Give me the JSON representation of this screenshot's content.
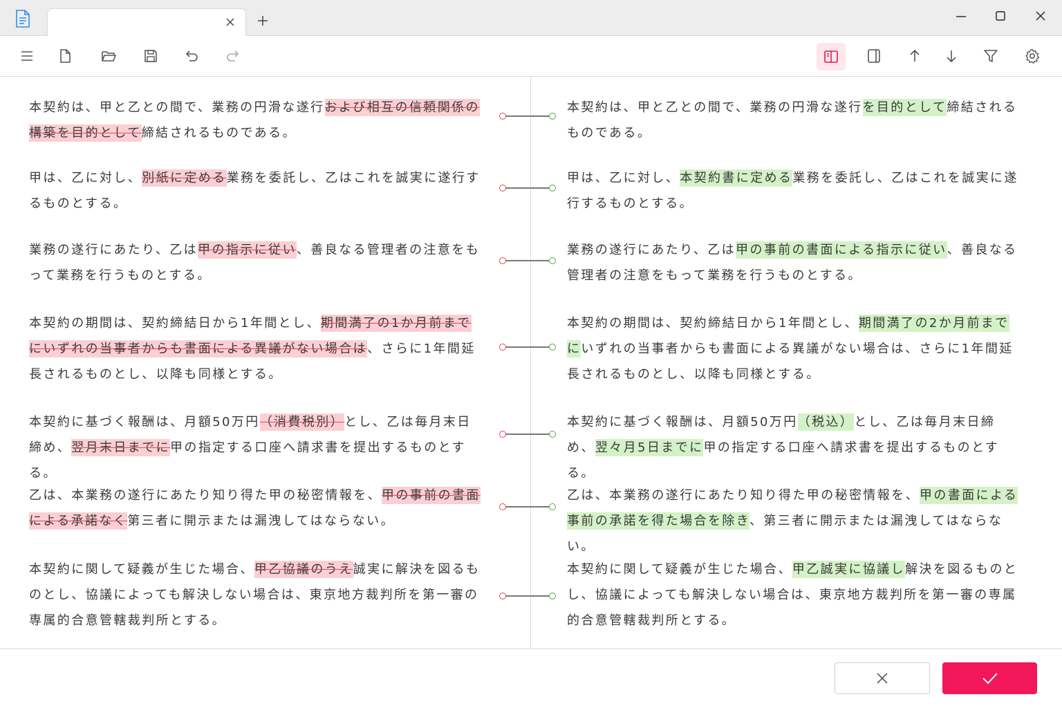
{
  "window": {
    "tab_title": "",
    "icons": {
      "app": "document-icon",
      "close_tab": "close-icon",
      "new_tab": "plus-icon",
      "minimize": "minimize-icon",
      "maximize": "maximize-icon",
      "close": "close-icon"
    }
  },
  "toolbar": {
    "buttons": [
      "menu-icon",
      "new-file-icon",
      "open-folder-icon",
      "save-icon",
      "undo-icon",
      "redo-icon",
      "side-by-side-view-icon",
      "single-pane-view-icon",
      "previous-change-icon",
      "next-change-icon",
      "filter-icon",
      "settings-icon"
    ],
    "active": "side-by-side-view-icon"
  },
  "colors": {
    "deleted_bg": "#fbcfd3",
    "deleted_strike": "#e0485c",
    "inserted_bg": "#d4f2c7",
    "accent": "#f2165a",
    "active_bg": "#fde7ec"
  },
  "diff": {
    "left": [
      [
        {
          "t": "本契約は、甲と乙との間で、業務の円滑な遂行"
        },
        {
          "t": "および相互の信頼関係の構築を目的として",
          "type": "del"
        },
        {
          "t": "締結されるものである。"
        }
      ],
      [
        {
          "t": "甲は、乙に対し、"
        },
        {
          "t": "別紙に定める",
          "type": "del"
        },
        {
          "t": "業務を委託し、乙はこれを誠実に遂行するものとする。"
        }
      ],
      [
        {
          "t": "業務の遂行にあたり、乙は"
        },
        {
          "t": "甲の指示に従い",
          "type": "del"
        },
        {
          "t": "、善良なる管理者の注意をもって業務を行うものとする。"
        }
      ],
      [
        {
          "t": "本契約の期間は、契約締結日から1年間とし、"
        },
        {
          "t": "期間満了の1か月前までにいずれの当事者からも書面による異議がない場合は",
          "type": "del"
        },
        {
          "t": "、さらに1年間延長されるものとし、以降も同様とする。"
        }
      ],
      [
        {
          "t": "本契約に基づく報酬は、月額50万円"
        },
        {
          "t": "（消費税別）",
          "type": "del"
        },
        {
          "t": "とし、乙は毎月末日締め、"
        },
        {
          "t": "翌月末日までに",
          "type": "del"
        },
        {
          "t": "甲の指定する口座へ請求書を提出するものとする。"
        }
      ],
      [
        {
          "t": "乙は、本業務の遂行にあたり知り得た甲の秘密情報を、"
        },
        {
          "t": "甲の事前の書面による承諾なく",
          "type": "del"
        },
        {
          "t": "第三者に開示または漏洩してはならない。"
        }
      ],
      [
        {
          "t": "本契約に関して疑義が生じた場合、"
        },
        {
          "t": "甲乙協議のうえ",
          "type": "del"
        },
        {
          "t": "誠実に解決を図るものとし、協議によっても解決しない場合は、東京地方裁判所を第一審の専属的合意管轄裁判所とする。"
        }
      ]
    ],
    "right": [
      [
        {
          "t": "本契約は、甲と乙との間で、業務の円滑な遂行"
        },
        {
          "t": "を目的として",
          "type": "ins"
        },
        {
          "t": "締結されるものである。"
        }
      ],
      [
        {
          "t": "甲は、乙に対し、"
        },
        {
          "t": "本契約書に定める",
          "type": "ins"
        },
        {
          "t": "業務を委託し、乙はこれを誠実に遂行するものとする。"
        }
      ],
      [
        {
          "t": "業務の遂行にあたり、乙は"
        },
        {
          "t": "甲の事前の書面による指示に従い",
          "type": "ins"
        },
        {
          "t": "、善良なる管理者の注意をもって業務を行うものとする。"
        }
      ],
      [
        {
          "t": "本契約の期間は、契約締結日から1年間とし、"
        },
        {
          "t": "期間満了の2か月前までに",
          "type": "ins"
        },
        {
          "t": "いずれの当事者からも書面による異議がない場合は、さらに1年間延長されるものとし、以降も同様とする。"
        }
      ],
      [
        {
          "t": "本契約に基づく報酬は、月額50万円"
        },
        {
          "t": "（税込）",
          "type": "ins"
        },
        {
          "t": "とし、乙は毎月末日締め、"
        },
        {
          "t": "翌々月5日までに",
          "type": "ins"
        },
        {
          "t": "甲の指定する口座へ請求書を提出するものとする。"
        }
      ],
      [
        {
          "t": "乙は、本業務の遂行にあたり知り得た甲の秘密情報を、"
        },
        {
          "t": "甲の書面による事前の承諾を得た場合を除き",
          "type": "ins"
        },
        {
          "t": "、第三者に開示または漏洩してはならない。"
        }
      ],
      [
        {
          "t": "本契約に関して疑義が生じた場合、"
        },
        {
          "t": "甲乙誠実に協議し",
          "type": "ins"
        },
        {
          "t": "解決を図るものとし、協議によっても解決しない場合は、東京地方裁判所を第一審の専属的合意管轄裁判所とする。"
        }
      ]
    ]
  },
  "footer": {
    "cancel_icon": "close-icon",
    "confirm_icon": "checkmark-icon"
  }
}
